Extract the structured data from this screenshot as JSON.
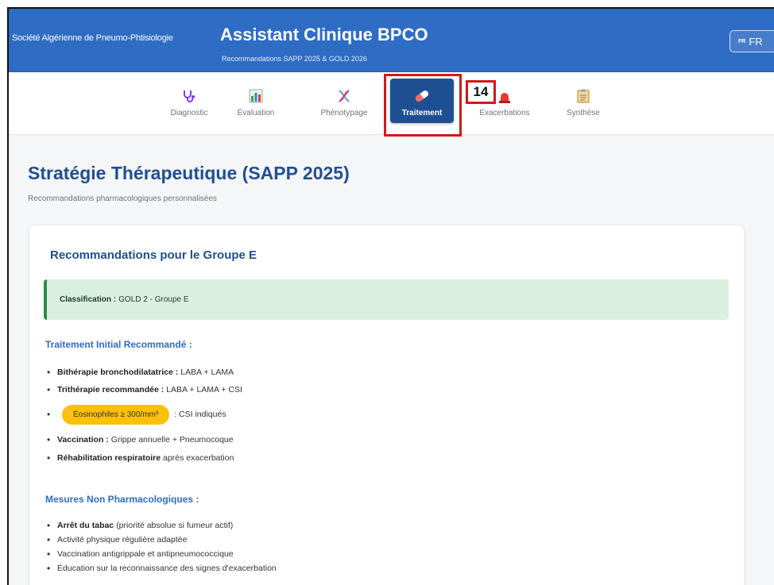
{
  "header": {
    "org": "Société Algérienne de Pneumo-Phtisiologie",
    "title": "Assistant Clinique BPCO",
    "subtitle": "Recommandations SAPP 2025 & GOLD 2026",
    "lang_flag": "FR",
    "lang_label": "FR"
  },
  "nav": {
    "tabs": [
      {
        "label": "Diagnostic",
        "icon": "stethoscope-icon"
      },
      {
        "label": "Évaluation",
        "icon": "chart-icon"
      },
      {
        "label": "Phénotypage",
        "icon": "dna-icon"
      },
      {
        "label": "Traitement",
        "icon": "pill-icon",
        "active": true
      },
      {
        "label": "Exacerbations",
        "icon": "alarm-icon"
      },
      {
        "label": "Synthèse",
        "icon": "clipboard-icon"
      }
    ],
    "marker": "14"
  },
  "page": {
    "title": "Stratégie Thérapeutique (SAPP 2025)",
    "subtitle": "Recommandations pharmacologiques personnalisées"
  },
  "card": {
    "title": "Recommandations pour le Groupe E",
    "classification_label": "Classification :",
    "classification_value": "GOLD 2 - Groupe E",
    "initial_heading": "Traitement Initial Recommandé :",
    "initial_items": [
      {
        "bold": "Bithérapie bronchodilatatrice :",
        "text": "LABA + LAMA"
      },
      {
        "bold": "Trithérapie recommandée :",
        "text": "LABA + LAMA + CSI"
      },
      {
        "pill": "Éosinophiles ≥ 300/mm³",
        "text": ": CSI indiqués"
      },
      {
        "bold": "Vaccination :",
        "text": "Grippe annuelle + Pneumocoque"
      },
      {
        "bold": "Réhabilitation respiratoire",
        "text": "après exacerbation"
      }
    ],
    "nonpharma_heading": "Mesures Non Pharmacologiques :",
    "nonpharma_items": [
      {
        "bold": "Arrêt du tabac",
        "text": "(priorité absolue si fumeur actif)"
      },
      {
        "text": "Activité physique régulière adaptée"
      },
      {
        "text": "Vaccination antigrippale et antipneumococcique"
      },
      {
        "text": "Éducation sur la reconnaissance des signes d'exacerbation"
      }
    ]
  },
  "colors": {
    "header_bg": "#2f6cc4",
    "active_tab": "#1f4f93",
    "title": "#1f4f93",
    "success_bg": "#d9f0de",
    "success_border": "#2e8b4a",
    "pill": "#ffc107",
    "highlight": "#d01919"
  }
}
